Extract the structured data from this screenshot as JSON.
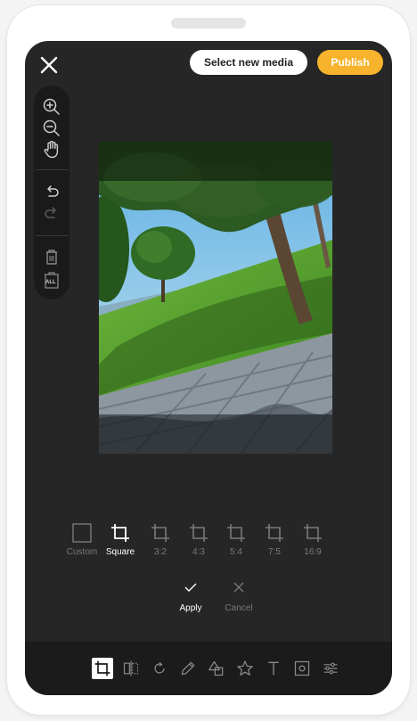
{
  "header": {
    "select_media_label": "Select new media",
    "publish_label": "Publish"
  },
  "colors": {
    "accent": "#f7b32b",
    "background": "#262626",
    "bar": "#1b1b1b"
  },
  "left_tools": [
    "zoom-in-icon",
    "zoom-out-icon",
    "hand-pan-icon",
    "undo-icon",
    "redo-icon",
    "delete-icon",
    "delete-all-icon"
  ],
  "delete_all_badge": "ALL",
  "crop_ratios": [
    {
      "label": "Custom",
      "icon": "custom-square-icon"
    },
    {
      "label": "Square",
      "icon": "crop-icon",
      "active": true
    },
    {
      "label": "3:2",
      "icon": "crop-icon"
    },
    {
      "label": "4:3",
      "icon": "crop-icon"
    },
    {
      "label": "5:4",
      "icon": "crop-icon"
    },
    {
      "label": "7:5",
      "icon": "crop-icon"
    },
    {
      "label": "16:9",
      "icon": "crop-icon"
    }
  ],
  "actions": {
    "apply_label": "Apply",
    "cancel_label": "Cancel"
  },
  "bottom_tools": [
    "crop-icon",
    "flip-icon",
    "rotate-icon",
    "pencil-icon",
    "shapes-icon",
    "star-icon",
    "text-icon",
    "frame-icon",
    "adjust-icon"
  ]
}
